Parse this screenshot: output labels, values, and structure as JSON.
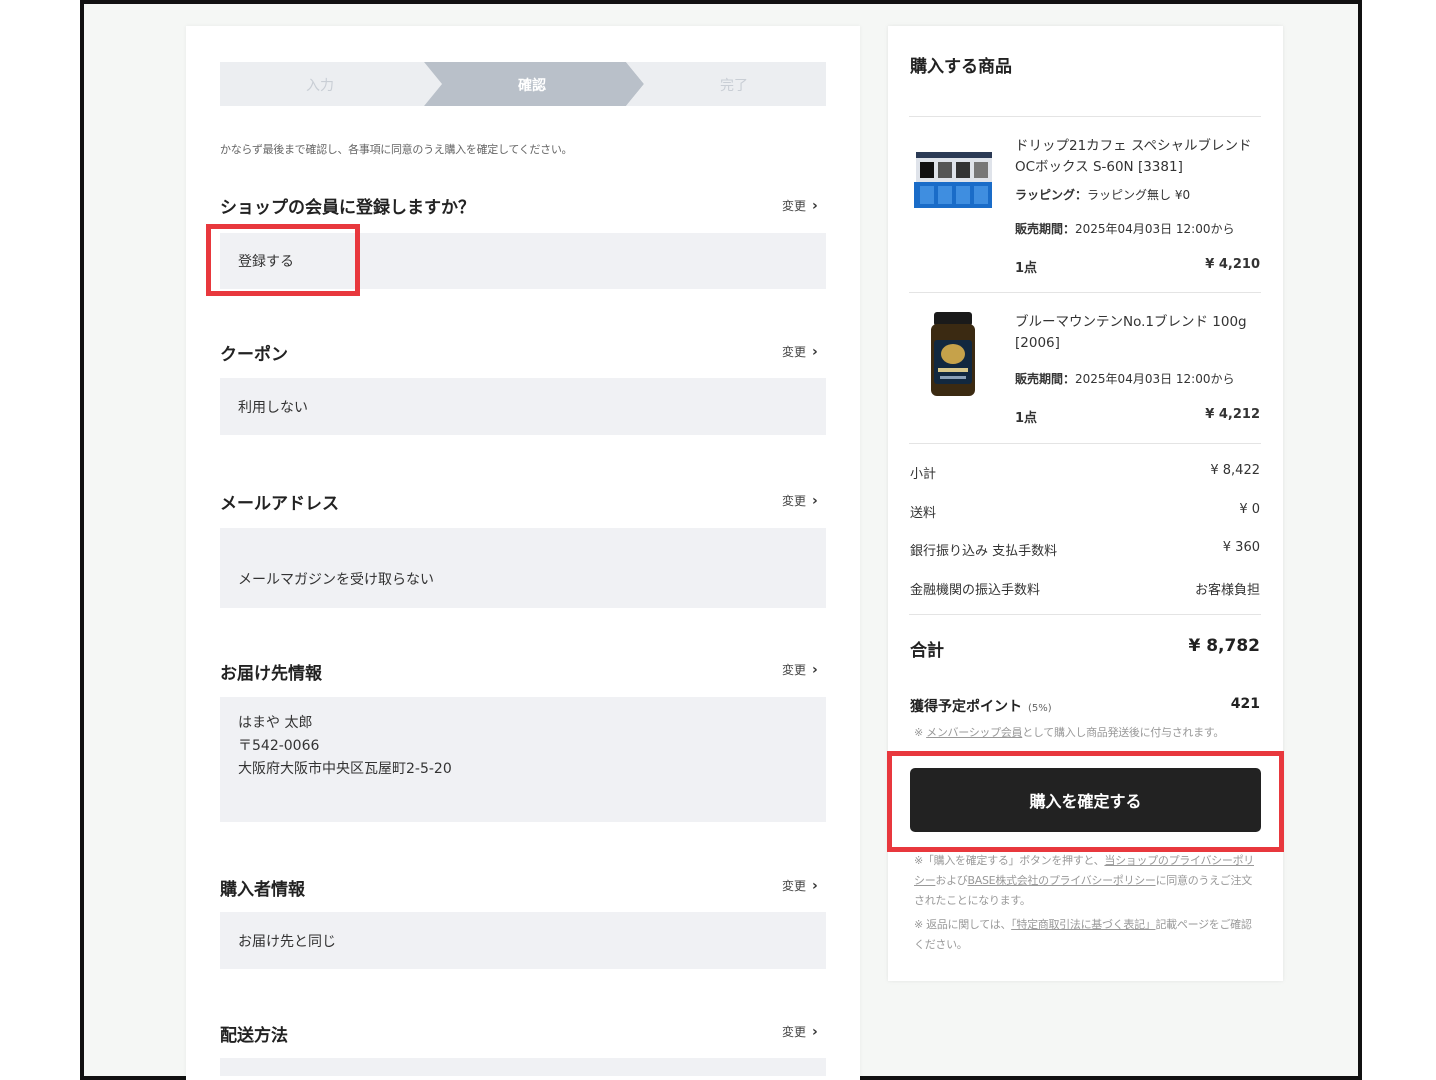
{
  "steps": [
    "入力",
    "確認",
    "完了"
  ],
  "notice": "かならず最後まで確認し、各事項に同意のうえ購入を確定してください。",
  "change_label": "変更",
  "sections": {
    "member": {
      "title": "ショップの会員に登録しますか？",
      "value": "登録する"
    },
    "coupon": {
      "title": "クーポン",
      "value": "利用しない"
    },
    "email": {
      "title": "メールアドレス",
      "value": "メールマガジンを受け取らない"
    },
    "shipping": {
      "title": "お届け先情報",
      "name": "はまや 太郎",
      "postal": "〒542-0066",
      "address": "大阪府大阪市中央区瓦屋町2-5-20"
    },
    "buyer": {
      "title": "購入者情報",
      "value": "お届け先と同じ"
    },
    "delivery": {
      "title": "配送方法"
    }
  },
  "cart": {
    "title": "購入する商品",
    "items": [
      {
        "name": "ドリップ21カフェ スペシャルブレンド OCボックス S-60N [3381]",
        "wrapping_label": "ラッピング：",
        "wrapping_value": "ラッピング無し ¥0",
        "period_label": "販売期間：",
        "period_value": "2025年04月03日 12:00から",
        "qty": "1点",
        "price": "¥ 4,210"
      },
      {
        "name": "ブルーマウンテンNo.1ブレンド 100g [2006]",
        "period_label": "販売期間：",
        "period_value": "2025年04月03日 12:00から",
        "qty": "1点",
        "price": "¥ 4,212"
      }
    ]
  },
  "summary": {
    "subtotal_label": "小計",
    "subtotal": "¥ 8,422",
    "shipping_label": "送料",
    "shipping": "¥ 0",
    "fee_label": "銀行振り込み 支払手数料",
    "fee": "¥ 360",
    "transfer_label": "金融機関の振込手数料",
    "transfer": "お客様負担",
    "total_label": "合計",
    "total": "¥ 8,782",
    "points_label": "獲得予定ポイント",
    "points_rate": "(5%)",
    "points": "421",
    "points_note_prefix": "※ ",
    "points_note_link": "メンバーシップ会員",
    "points_note_suffix": "として購入し商品発送後に付与されます。"
  },
  "buy_button": "購入を確定する",
  "fine_print": {
    "p1_a": "※「購入を確定する」ボタンを押すと、",
    "p1_link1": "当ショップのプライバシーポリシー",
    "p1_b": "および",
    "p1_link2": "BASE株式会社のプライバシーポリシー",
    "p1_c": "に同意のうえご注文されたことになります。",
    "p2_a": "※ 返品に関しては、",
    "p2_link": "「特定商取引法に基づく表記」",
    "p2_b": "記載ページをご確認ください。"
  }
}
